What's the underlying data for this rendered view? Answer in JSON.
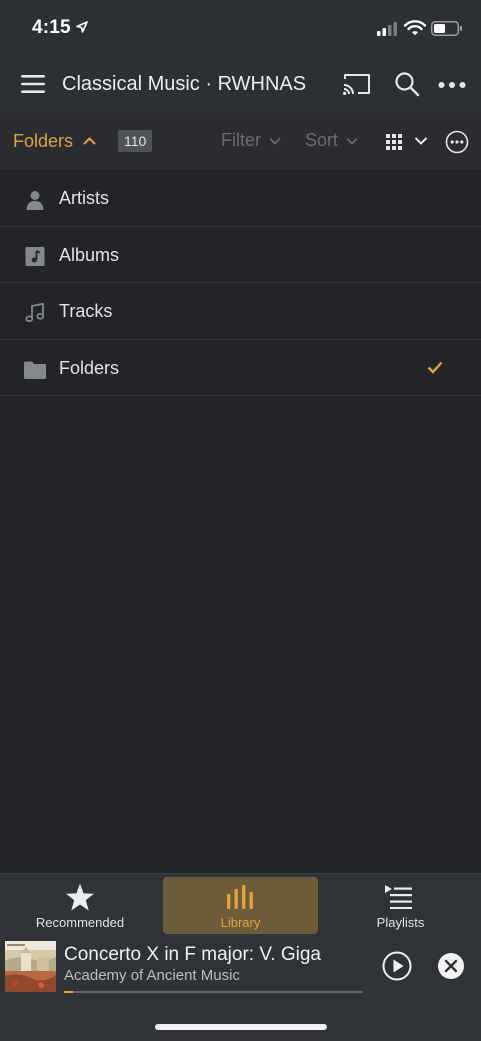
{
  "status_bar": {
    "time": "4:15",
    "icons": [
      "location-arrow-icon",
      "cellular-signal-icon",
      "wifi-icon",
      "battery-icon"
    ]
  },
  "header": {
    "title": "Classical Music · RWHNAS",
    "icons": [
      "hamburger-menu-icon",
      "cast-icon",
      "search-icon",
      "more-horizontal-icon"
    ]
  },
  "toolbar": {
    "section_label": "Folders",
    "count": "110",
    "filter_label": "Filter",
    "sort_label": "Sort",
    "accent_color": "#e5a23a"
  },
  "library_types": [
    {
      "label": "Artists",
      "icon": "person-icon",
      "selected": false
    },
    {
      "label": "Albums",
      "icon": "album-icon",
      "selected": false
    },
    {
      "label": "Tracks",
      "icon": "music-note-icon",
      "selected": false
    },
    {
      "label": "Folders",
      "icon": "folder-icon",
      "selected": true
    }
  ],
  "bottom_nav": {
    "tabs": [
      {
        "label": "Recommended",
        "icon": "star-icon",
        "active": false
      },
      {
        "label": "Library",
        "icon": "library-bars-icon",
        "active": true
      },
      {
        "label": "Playlists",
        "icon": "playlist-icon",
        "active": false
      }
    ]
  },
  "now_playing": {
    "title": "Concerto X in F major: V. Giga",
    "artist": "Academy of Ancient Music",
    "progress": 0.03
  }
}
